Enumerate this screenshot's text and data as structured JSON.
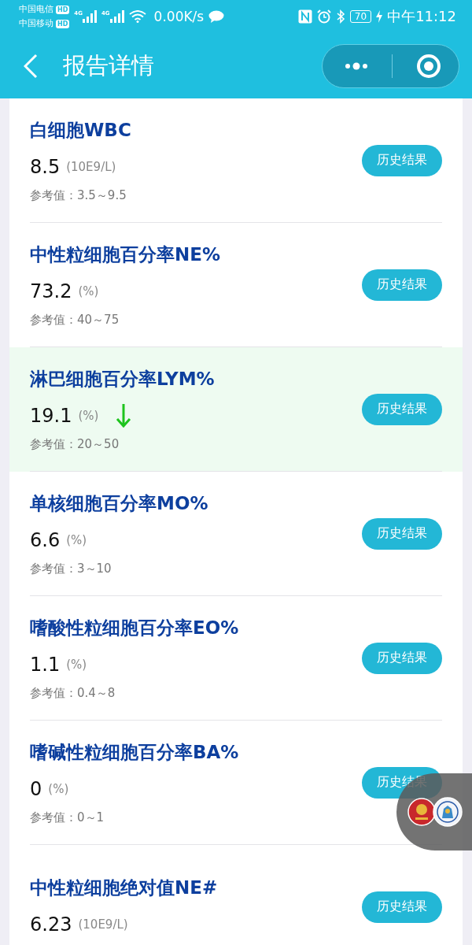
{
  "status_bar": {
    "carriers": [
      "中国电信",
      "中国移动"
    ],
    "hd_badges": [
      "HD",
      "HD"
    ],
    "network_types": [
      "4G",
      "4G"
    ],
    "speed": "0.00K/s",
    "battery": "70",
    "time": "中午11:12"
  },
  "header": {
    "title": "报告详情"
  },
  "results": [
    {
      "name": "白细胞WBC",
      "value": "8.5",
      "unit": "(10E9/L)",
      "reference": "参考值：3.5～9.5",
      "button": "历史结果",
      "below_range": false
    },
    {
      "name": "中性粒细胞百分率NE%",
      "value": "73.2",
      "unit": "(%)",
      "reference": "参考值：40～75",
      "button": "历史结果",
      "below_range": false
    },
    {
      "name": "淋巴细胞百分率LYM%",
      "value": "19.1",
      "unit": "(%)",
      "reference": "参考值：20～50",
      "button": "历史结果",
      "below_range": true
    },
    {
      "name": "单核细胞百分率MO%",
      "value": "6.6",
      "unit": "(%)",
      "reference": "参考值：3～10",
      "button": "历史结果",
      "below_range": false
    },
    {
      "name": "嗜酸性粒细胞百分率EO%",
      "value": "1.1",
      "unit": "(%)",
      "reference": "参考值：0.4～8",
      "button": "历史结果",
      "below_range": false
    },
    {
      "name": "嗜碱性粒细胞百分率BA%",
      "value": "0",
      "unit": "(%)",
      "reference": "参考值：0～1",
      "button": "历史结果",
      "below_range": false
    },
    {
      "name": "中性粒细胞绝对值NE#",
      "value": "6.23",
      "unit": "(10E9/L)",
      "button": "历史结果",
      "below_range": false
    }
  ]
}
